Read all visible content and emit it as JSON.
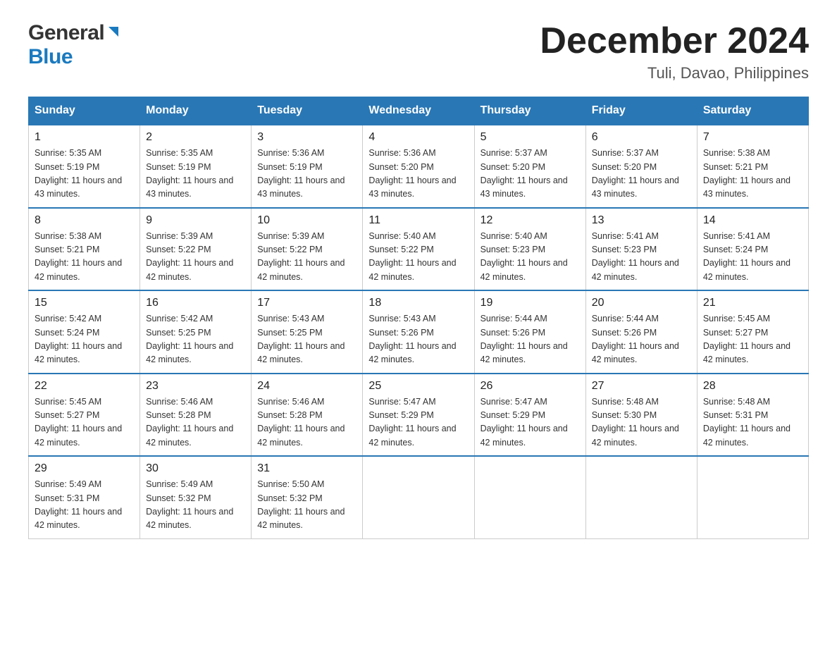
{
  "header": {
    "logo_general": "General",
    "logo_blue": "Blue",
    "month_title": "December 2024",
    "location": "Tuli, Davao, Philippines"
  },
  "days_of_week": [
    "Sunday",
    "Monday",
    "Tuesday",
    "Wednesday",
    "Thursday",
    "Friday",
    "Saturday"
  ],
  "weeks": [
    [
      {
        "day": "1",
        "sunrise": "5:35 AM",
        "sunset": "5:19 PM",
        "daylight": "11 hours and 43 minutes."
      },
      {
        "day": "2",
        "sunrise": "5:35 AM",
        "sunset": "5:19 PM",
        "daylight": "11 hours and 43 minutes."
      },
      {
        "day": "3",
        "sunrise": "5:36 AM",
        "sunset": "5:19 PM",
        "daylight": "11 hours and 43 minutes."
      },
      {
        "day": "4",
        "sunrise": "5:36 AM",
        "sunset": "5:20 PM",
        "daylight": "11 hours and 43 minutes."
      },
      {
        "day": "5",
        "sunrise": "5:37 AM",
        "sunset": "5:20 PM",
        "daylight": "11 hours and 43 minutes."
      },
      {
        "day": "6",
        "sunrise": "5:37 AM",
        "sunset": "5:20 PM",
        "daylight": "11 hours and 43 minutes."
      },
      {
        "day": "7",
        "sunrise": "5:38 AM",
        "sunset": "5:21 PM",
        "daylight": "11 hours and 43 minutes."
      }
    ],
    [
      {
        "day": "8",
        "sunrise": "5:38 AM",
        "sunset": "5:21 PM",
        "daylight": "11 hours and 42 minutes."
      },
      {
        "day": "9",
        "sunrise": "5:39 AM",
        "sunset": "5:22 PM",
        "daylight": "11 hours and 42 minutes."
      },
      {
        "day": "10",
        "sunrise": "5:39 AM",
        "sunset": "5:22 PM",
        "daylight": "11 hours and 42 minutes."
      },
      {
        "day": "11",
        "sunrise": "5:40 AM",
        "sunset": "5:22 PM",
        "daylight": "11 hours and 42 minutes."
      },
      {
        "day": "12",
        "sunrise": "5:40 AM",
        "sunset": "5:23 PM",
        "daylight": "11 hours and 42 minutes."
      },
      {
        "day": "13",
        "sunrise": "5:41 AM",
        "sunset": "5:23 PM",
        "daylight": "11 hours and 42 minutes."
      },
      {
        "day": "14",
        "sunrise": "5:41 AM",
        "sunset": "5:24 PM",
        "daylight": "11 hours and 42 minutes."
      }
    ],
    [
      {
        "day": "15",
        "sunrise": "5:42 AM",
        "sunset": "5:24 PM",
        "daylight": "11 hours and 42 minutes."
      },
      {
        "day": "16",
        "sunrise": "5:42 AM",
        "sunset": "5:25 PM",
        "daylight": "11 hours and 42 minutes."
      },
      {
        "day": "17",
        "sunrise": "5:43 AM",
        "sunset": "5:25 PM",
        "daylight": "11 hours and 42 minutes."
      },
      {
        "day": "18",
        "sunrise": "5:43 AM",
        "sunset": "5:26 PM",
        "daylight": "11 hours and 42 minutes."
      },
      {
        "day": "19",
        "sunrise": "5:44 AM",
        "sunset": "5:26 PM",
        "daylight": "11 hours and 42 minutes."
      },
      {
        "day": "20",
        "sunrise": "5:44 AM",
        "sunset": "5:26 PM",
        "daylight": "11 hours and 42 minutes."
      },
      {
        "day": "21",
        "sunrise": "5:45 AM",
        "sunset": "5:27 PM",
        "daylight": "11 hours and 42 minutes."
      }
    ],
    [
      {
        "day": "22",
        "sunrise": "5:45 AM",
        "sunset": "5:27 PM",
        "daylight": "11 hours and 42 minutes."
      },
      {
        "day": "23",
        "sunrise": "5:46 AM",
        "sunset": "5:28 PM",
        "daylight": "11 hours and 42 minutes."
      },
      {
        "day": "24",
        "sunrise": "5:46 AM",
        "sunset": "5:28 PM",
        "daylight": "11 hours and 42 minutes."
      },
      {
        "day": "25",
        "sunrise": "5:47 AM",
        "sunset": "5:29 PM",
        "daylight": "11 hours and 42 minutes."
      },
      {
        "day": "26",
        "sunrise": "5:47 AM",
        "sunset": "5:29 PM",
        "daylight": "11 hours and 42 minutes."
      },
      {
        "day": "27",
        "sunrise": "5:48 AM",
        "sunset": "5:30 PM",
        "daylight": "11 hours and 42 minutes."
      },
      {
        "day": "28",
        "sunrise": "5:48 AM",
        "sunset": "5:31 PM",
        "daylight": "11 hours and 42 minutes."
      }
    ],
    [
      {
        "day": "29",
        "sunrise": "5:49 AM",
        "sunset": "5:31 PM",
        "daylight": "11 hours and 42 minutes."
      },
      {
        "day": "30",
        "sunrise": "5:49 AM",
        "sunset": "5:32 PM",
        "daylight": "11 hours and 42 minutes."
      },
      {
        "day": "31",
        "sunrise": "5:50 AM",
        "sunset": "5:32 PM",
        "daylight": "11 hours and 42 minutes."
      },
      null,
      null,
      null,
      null
    ]
  ],
  "labels": {
    "sunrise_prefix": "Sunrise: ",
    "sunset_prefix": "Sunset: ",
    "daylight_prefix": "Daylight: "
  }
}
